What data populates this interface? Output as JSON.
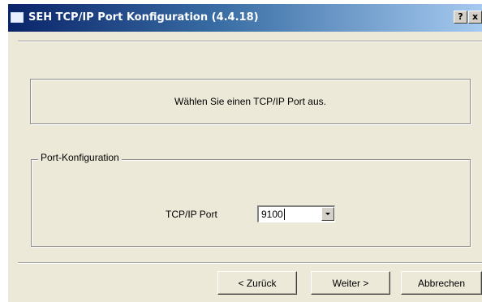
{
  "window": {
    "title": "SEH TCP/IP Port Konfiguration (4.4.18)",
    "help_label": "?",
    "close_label": "x"
  },
  "message": "Wählen Sie einen TCP/IP Port aus.",
  "port_config": {
    "group_title": "Port-Konfiguration",
    "port_label": "TCP/IP Port",
    "port_value": "9100"
  },
  "buttons": {
    "back": "< Zurück",
    "next": "Weiter >",
    "cancel": "Abbrechen"
  },
  "colors": {
    "dialog_background": "#ece9d8",
    "titlebar_start": "#0a246a",
    "titlebar_end": "#a6caf0"
  }
}
